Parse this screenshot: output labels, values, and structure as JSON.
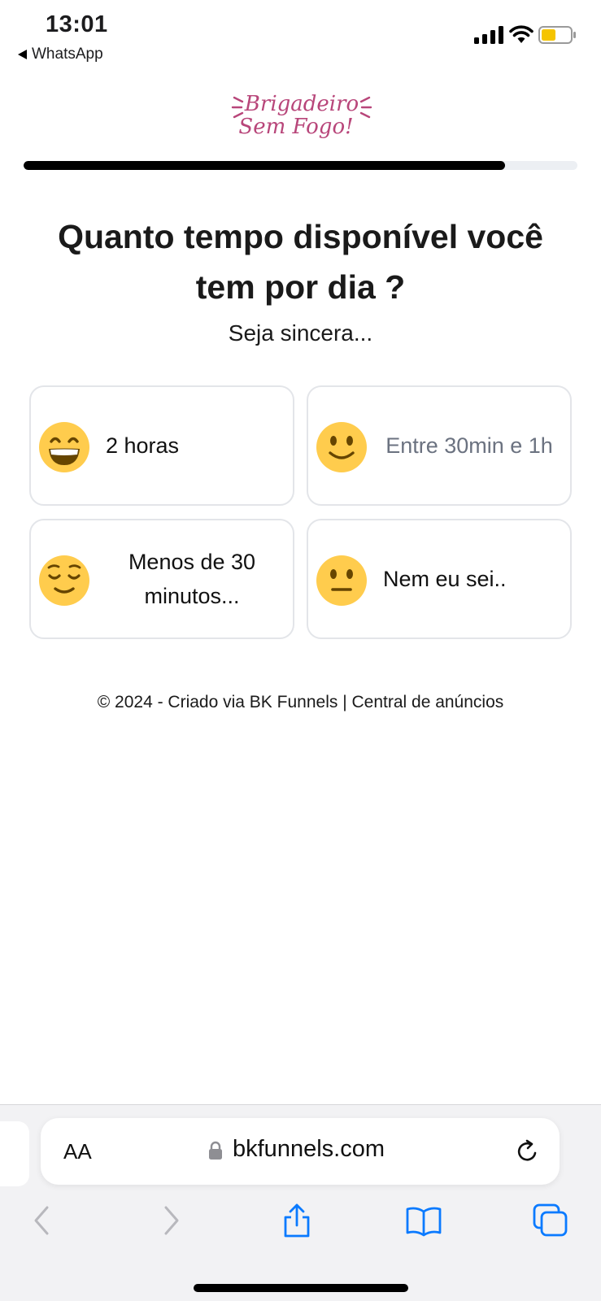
{
  "status_bar": {
    "time": "13:01",
    "back_app": "WhatsApp",
    "icons": [
      "cellular-signal-icon",
      "wifi-icon",
      "battery-icon"
    ],
    "battery_color": "#f5c400"
  },
  "brand": {
    "logo_text_line1": "Brigadeiro",
    "logo_text_line2": "Sem Fogo!",
    "logo_color": "#b8467a"
  },
  "progress": {
    "fraction": 0.87,
    "fill_color": "#000000",
    "track_color": "#eceff3"
  },
  "quiz": {
    "question": "Quanto tempo disponível você tem por dia ?",
    "subtitle": "Seja sincera...",
    "options": [
      {
        "label": "2 horas",
        "emoji": "grinning-smiling-eyes-emoji"
      },
      {
        "label": "Entre 30min e 1h",
        "emoji": "slightly-smiling-emoji"
      },
      {
        "label": "Menos de 30 minutos...",
        "emoji": "relieved-emoji"
      },
      {
        "label": "Nem eu sei..",
        "emoji": "neutral-face-emoji"
      }
    ]
  },
  "footer": {
    "text": "© 2024 - Criado via BK Funnels | Central de anúncios"
  },
  "browser": {
    "text_size_button": "AA",
    "url": "bkfunnels.com",
    "icons": [
      "lock-icon",
      "reload-icon",
      "back-icon",
      "forward-icon",
      "share-icon",
      "bookmarks-icon",
      "tabs-icon"
    ],
    "accent_color": "#0a7aff"
  }
}
